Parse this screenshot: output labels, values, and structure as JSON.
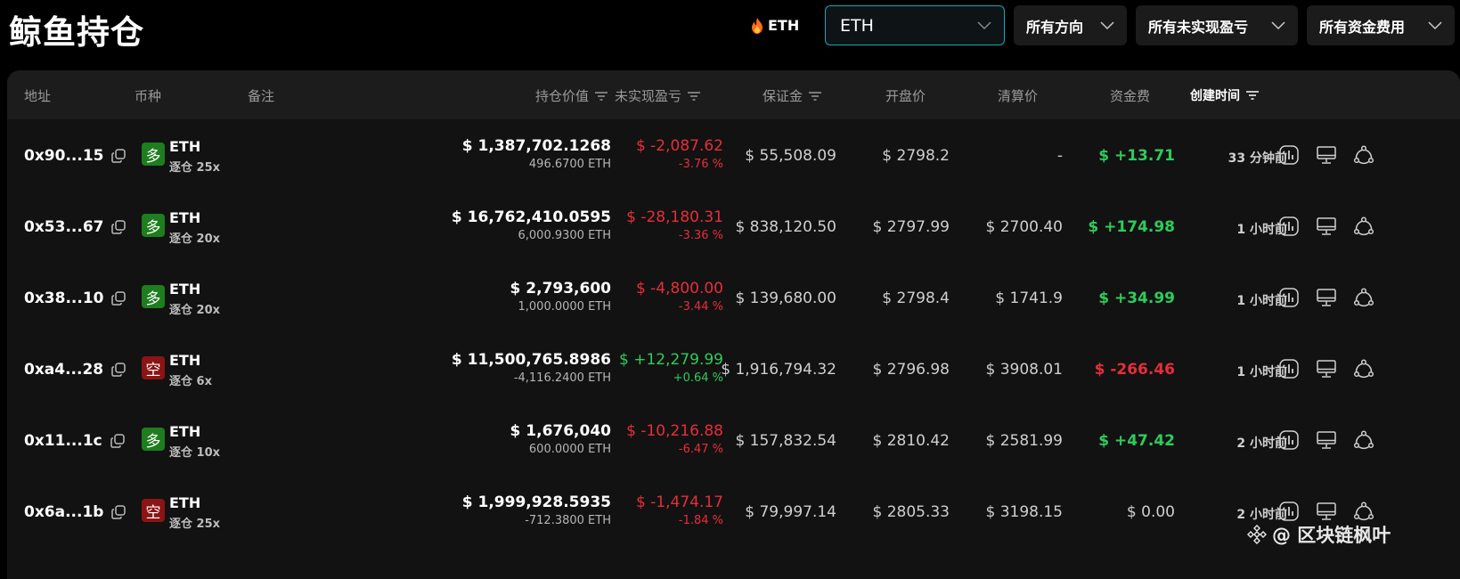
{
  "header": {
    "title": "鲸鱼持仓",
    "hot_coin": "ETH",
    "coin_select": "ETH",
    "direction_select": "所有方向",
    "pnl_select": "所有未实现盈亏",
    "funding_select": "所有资金费用"
  },
  "columns": {
    "address": "地址",
    "coin": "币种",
    "note": "备注",
    "position_value": "持仓价值",
    "unrealized_pnl": "未实现盈亏",
    "margin": "保证金",
    "open_price": "开盘价",
    "liq_price": "清算价",
    "funding": "资金费",
    "created": "创建时间"
  },
  "rows": [
    {
      "address": "0x90...15",
      "side": "多",
      "side_type": "long",
      "coin": "ETH",
      "leverage": "逐仓 25x",
      "position_value": "$ 1,387,702.1268",
      "position_size": "496.6700 ETH",
      "pnl": "$ -2,087.62",
      "pnl_pct": "-3.76 %",
      "pnl_dir": "neg",
      "margin": "$ 55,508.09",
      "open_price": "$ 2798.2",
      "liq_price": "-",
      "funding": "$ +13.71",
      "funding_dir": "pos",
      "created": "33 分钟前"
    },
    {
      "address": "0x53...67",
      "side": "多",
      "side_type": "long",
      "coin": "ETH",
      "leverage": "逐仓 20x",
      "position_value": "$ 16,762,410.0595",
      "position_size": "6,000.9300 ETH",
      "pnl": "$ -28,180.31",
      "pnl_pct": "-3.36 %",
      "pnl_dir": "neg",
      "margin": "$ 838,120.50",
      "open_price": "$ 2797.99",
      "liq_price": "$ 2700.40",
      "funding": "$ +174.98",
      "funding_dir": "pos",
      "created": "1 小时前"
    },
    {
      "address": "0x38...10",
      "side": "多",
      "side_type": "long",
      "coin": "ETH",
      "leverage": "逐仓 20x",
      "position_value": "$ 2,793,600",
      "position_size": "1,000.0000 ETH",
      "pnl": "$ -4,800.00",
      "pnl_pct": "-3.44 %",
      "pnl_dir": "neg",
      "margin": "$ 139,680.00",
      "open_price": "$ 2798.4",
      "liq_price": "$ 1741.9",
      "funding": "$ +34.99",
      "funding_dir": "pos",
      "created": "1 小时前"
    },
    {
      "address": "0xa4...28",
      "side": "空",
      "side_type": "short",
      "coin": "ETH",
      "leverage": "逐仓 6x",
      "position_value": "$ 11,500,765.8986",
      "position_size": "-4,116.2400 ETH",
      "pnl": "$ +12,279.99",
      "pnl_pct": "+0.64 %",
      "pnl_dir": "pos",
      "margin": "$ 1,916,794.32",
      "open_price": "$ 2796.98",
      "liq_price": "$ 3908.01",
      "funding": "$ -266.46",
      "funding_dir": "neg",
      "created": "1 小时前"
    },
    {
      "address": "0x11...1c",
      "side": "多",
      "side_type": "long",
      "coin": "ETH",
      "leverage": "逐仓 10x",
      "position_value": "$ 1,676,040",
      "position_size": "600.0000 ETH",
      "pnl": "$ -10,216.88",
      "pnl_pct": "-6.47 %",
      "pnl_dir": "neg",
      "margin": "$ 157,832.54",
      "open_price": "$ 2810.42",
      "liq_price": "$ 2581.99",
      "funding": "$ +47.42",
      "funding_dir": "pos",
      "created": "2 小时前"
    },
    {
      "address": "0x6a...1b",
      "side": "空",
      "side_type": "short",
      "coin": "ETH",
      "leverage": "逐仓 25x",
      "position_value": "$ 1,999,928.5935",
      "position_size": "-712.3800 ETH",
      "pnl": "$ -1,474.17",
      "pnl_pct": "-1.84 %",
      "pnl_dir": "neg",
      "margin": "$ 79,997.14",
      "open_price": "$ 2805.33",
      "liq_price": "$ 3198.15",
      "funding": "$ 0.00",
      "funding_dir": "zero",
      "created": "2 小时前"
    }
  ],
  "watermark": "@ 区块链枫叶",
  "colors": {
    "accent": "#1aa3b8",
    "positive": "#2dcc5a",
    "negative": "#e62e3a",
    "long_badge": "#1e7d1e",
    "short_badge": "#8b1414"
  }
}
